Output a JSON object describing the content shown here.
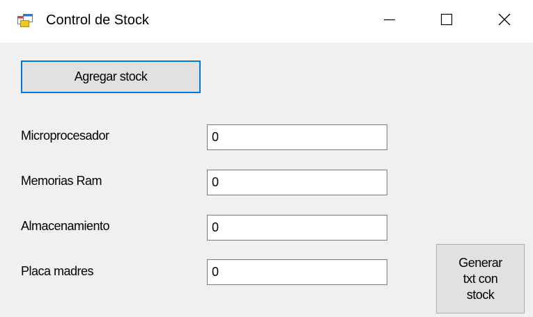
{
  "window": {
    "title": "Control de Stock",
    "icon": "winforms-app-icon",
    "controls": {
      "minimize_icon": "minimize-icon",
      "maximize_icon": "maximize-icon",
      "close_icon": "close-icon"
    }
  },
  "buttons": {
    "agregar_label": "Agregar stock",
    "generar_label_lines": [
      "Generar",
      "txt con",
      "stock"
    ]
  },
  "fields": [
    {
      "label": "Microprocesador",
      "value": "0"
    },
    {
      "label": "Memorias Ram",
      "value": "0"
    },
    {
      "label": "Almacenamiento",
      "value": "0"
    },
    {
      "label": "Placa madres",
      "value": "0"
    }
  ],
  "colors": {
    "focus_border": "#0078d7",
    "button_face": "#e1e1e1",
    "client_background": "#f0f0f0"
  }
}
